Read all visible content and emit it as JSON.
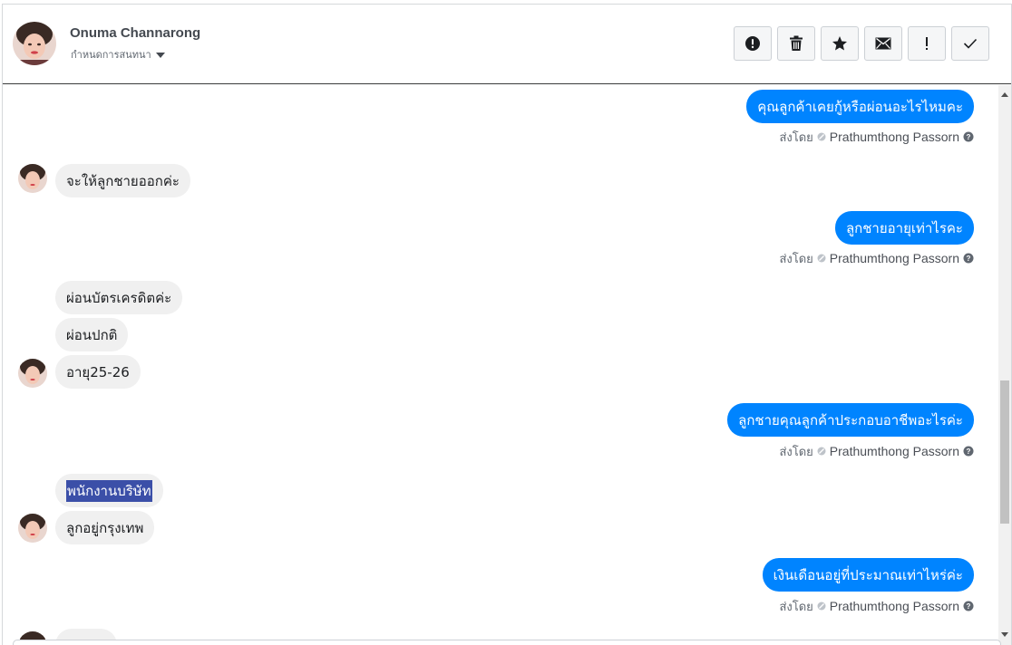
{
  "header": {
    "contact_name": "Onuma Channarong",
    "assign_label": "กำหนดการสนทนา",
    "actions": [
      {
        "name": "spam",
        "icon": "exclamation-circle-icon"
      },
      {
        "name": "delete",
        "icon": "trash-icon"
      },
      {
        "name": "star",
        "icon": "star-icon"
      },
      {
        "name": "mark-unread",
        "icon": "envelope-icon"
      },
      {
        "name": "follow-up",
        "icon": "exclamation-icon"
      },
      {
        "name": "mark-done",
        "icon": "check-icon"
      }
    ]
  },
  "messages": {
    "m1": {
      "direction": "out",
      "text": "คุณลูกค้าเคยกู้หรือผ่อนอะไรไหมคะ"
    },
    "m2": {
      "direction": "in",
      "text": "จะให้ลูกชายออกค่ะ"
    },
    "m3": {
      "direction": "out",
      "text": "ลูกชายอายุเท่าไรคะ"
    },
    "m4": {
      "direction": "in",
      "text": "ผ่อนบัตรเครดิตค่ะ"
    },
    "m5": {
      "direction": "in",
      "text": "ผ่อนปกติ"
    },
    "m6": {
      "direction": "in",
      "text": "อายุ25-26"
    },
    "m7": {
      "direction": "out",
      "text": "ลูกชายคุณลูกค้าประกอบอาชีพอะไรค่ะ"
    },
    "m8": {
      "direction": "in",
      "text": "พนักงานบริษัท",
      "selected": true
    },
    "m9": {
      "direction": "in",
      "text": "ลูกอยู่กรุงเทพ"
    },
    "m10": {
      "direction": "out",
      "text": "เงินเดือนอยู่ที่ประมาณเท่าไหร่ค่ะ"
    }
  },
  "sent_by": {
    "prefix": "ส่งโดย",
    "agent": "Prathumthong Passorn"
  },
  "colors": {
    "outgoing_bubble": "#0084ff",
    "incoming_bubble": "#f0f0f0",
    "selection": "#3b4fa8"
  }
}
